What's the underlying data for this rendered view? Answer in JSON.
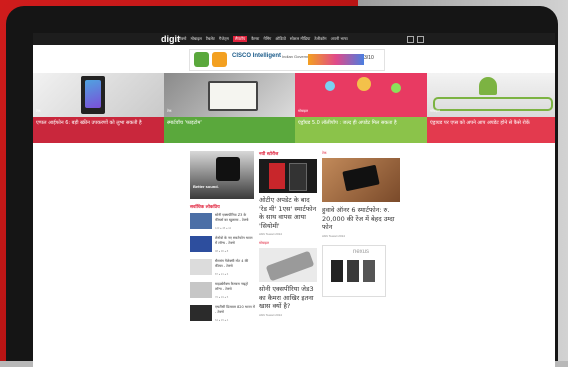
{
  "site": {
    "logo": "digit"
  },
  "nav": {
    "items": [
      "टेक्नो",
      "मोबाइल",
      "टैबलेट",
      "गैजेट्स",
      "लैपटॉप",
      "कैमरा",
      "गेमिंग",
      "ऑडियो",
      "सोशल मीडिया",
      "टेलीकॉम",
      "अपनी भाषा"
    ],
    "active_index": 4
  },
  "ad": {
    "title": "CISCO Intelligent",
    "subtitle": "Indian Government",
    "action": "3/10"
  },
  "banners": [
    {
      "category": "टेक",
      "title": "एप्पल आईफोन 6: बड़ी स्क्रीन उपकरणों को लुभा सकती है",
      "caption_color": "#c9273c"
    },
    {
      "category": "टेक",
      "title": "स्मार्टवॉच 'फाइटोम'",
      "caption_color": "#5aa83c"
    },
    {
      "category": "मोबाइल",
      "title": "एंड्रॉयड 5.0 लॉलीपॉप : जल्द ही अपडेट मिल सकता है",
      "caption_color": "#8bc34a"
    },
    {
      "category": "मोबाइल",
      "title": "एंड्रायड पर एप्स को अपने आप अपडेट होने से कैसे रोकें",
      "caption_color": "#e33a4e"
    }
  ],
  "left": {
    "ad_text": "Better sound.",
    "section_title": "सर्वाधिक लोकप्रिय",
    "items": [
      {
        "title": "सोनी एक्सपीरिया Z3 के फीचर्स का खुलासा - टेक्नो",
        "meta": "123 ● 45 ● 12"
      },
      {
        "title": "लेनोवो के नए स्मार्टफोन भारत में लॉन्च - टेक्नो",
        "meta": "98 ● 30 ● 8"
      },
      {
        "title": "सैमसंग गैलेक्सी नोट 4 की कीमत - टेक्नो",
        "meta": "87 ● 21 ● 6"
      },
      {
        "title": "माइक्रोमैक्स कैनवस नाइट्रो लॉन्च - टेक्नो",
        "meta": "76 ● 19 ● 5"
      },
      {
        "title": "एचटीसी डिजायर 820 भारत में - टेक्नो",
        "meta": "64 ● 15 ● 4"
      }
    ]
  },
  "mid": {
    "section_title": "नयी स्टोरीज",
    "stories": [
      {
        "category": "मोबाइल",
        "title": "ओटीए अपडेट के बाद 'रेड मी' 1एस' स्मार्टफोन के साथ वापस आया 'सियोमी'",
        "meta": "Abhi Tewari 2014"
      },
      {
        "category": "मोबाइल",
        "title": "सोनी एक्सपीरिया जेड3 का कैमरा आखिर इतना खास क्यों है?",
        "meta": "Abhi Tewari 2014"
      }
    ]
  },
  "right": {
    "stories": [
      {
        "category": "टेक",
        "title": "हुवावे ऑनर 6 स्मार्टफोन: रु. 20,000 की रेंज में बेहद उम्दा फोन",
        "meta": "Abhi Tewari 2014"
      }
    ],
    "ad_text": "nexus"
  }
}
